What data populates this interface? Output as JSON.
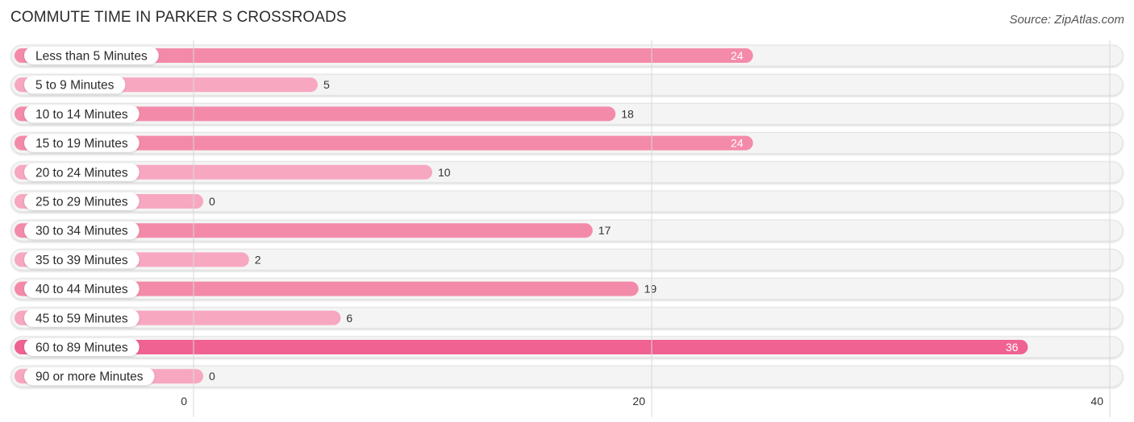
{
  "chart_data": {
    "type": "bar",
    "orientation": "horizontal",
    "title": "COMMUTE TIME IN PARKER S CROSSROADS",
    "source": "Source: ZipAtlas.com",
    "xlabel": "",
    "ylabel": "",
    "xlim": [
      0,
      40
    ],
    "x_ticks": [
      0,
      20,
      40
    ],
    "grid": true,
    "legend": "none",
    "categories": [
      "Less than 5 Minutes",
      "5 to 9 Minutes",
      "10 to 14 Minutes",
      "15 to 19 Minutes",
      "20 to 24 Minutes",
      "25 to 29 Minutes",
      "30 to 34 Minutes",
      "35 to 39 Minutes",
      "40 to 44 Minutes",
      "45 to 59 Minutes",
      "60 to 89 Minutes",
      "90 or more Minutes"
    ],
    "values": [
      24,
      5,
      18,
      24,
      10,
      0,
      17,
      2,
      19,
      6,
      36,
      0
    ],
    "colors": {
      "bar_strong": "#f06292",
      "bar_medium": "#f48aaa",
      "bar_light": "#f7a8c0",
      "track": "#f4f4f4",
      "grid": "#d8d8d8"
    }
  }
}
